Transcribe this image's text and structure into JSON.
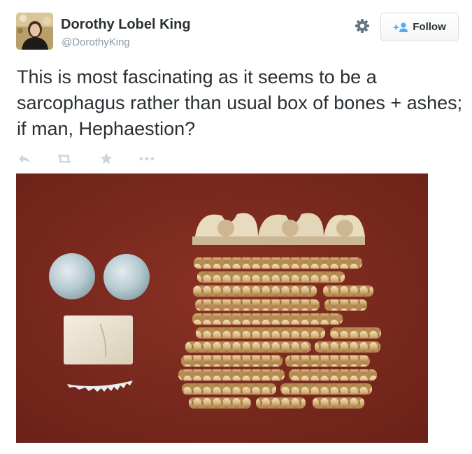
{
  "user": {
    "name": "Dorothy Lobel King",
    "handle": "@DorothyKing"
  },
  "header": {
    "follow_label": "Follow",
    "settings_icon": "gear-icon"
  },
  "tweet": {
    "text": "This is most fascinating as it seems to be a sarcophagus rather than usual box of bones + ashes; if man, Hephaestion?"
  },
  "actions": [
    "reply-icon",
    "retweet-icon",
    "favorite-icon",
    "more-icon"
  ],
  "colors": {
    "text": "#292f33",
    "muted": "#8899a6",
    "action": "#ccd6dd",
    "follow_icon": "#55acee",
    "photo_background": "#7d2a20"
  }
}
